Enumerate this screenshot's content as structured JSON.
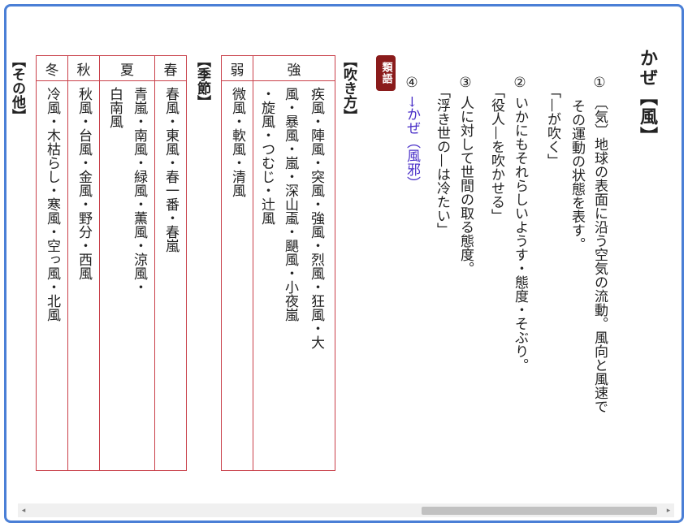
{
  "entry": {
    "reading": "かぜ",
    "headword": "【風】",
    "senses": [
      {
        "num": "①",
        "label": "〔気〕",
        "text": "地球の表面に沿う空気の流動。風向と風速で",
        "text2": "その運動の状態を表す。",
        "example": "「—が吹く」"
      },
      {
        "num": "②",
        "text": "いかにもそれらしいようす・態度・そぶり。",
        "example": "「役人—を吹かせる」"
      },
      {
        "num": "③",
        "text": "人に対して世間の取る態度。",
        "example": "「浮き世の—は冷たい」"
      },
      {
        "num": "④",
        "arrow": "→",
        "link": "かぜ（風邪）"
      }
    ]
  },
  "badge": "類語",
  "blow": {
    "title": "【吹き方】",
    "strong": {
      "head": "強",
      "line1": "疾風・陣風・突風・強風・烈風・狂風・大",
      "line2": "風・暴風・嵐・深山颪・颶風・小夜嵐",
      "line3": "・旋風・つむじ・辻風"
    },
    "weak": {
      "head": "弱",
      "line1": "微風・軟風・清風"
    }
  },
  "season": {
    "title": "【季節】",
    "spring": {
      "head": "春",
      "line1": "春風・東風・春一番・春嵐"
    },
    "summer": {
      "head": "夏",
      "line1": "青嵐・南風・緑風・薫風・涼風・",
      "line2": "白南風"
    },
    "autumn": {
      "head": "秋",
      "line1": "秋風・台風・金風・野分・西風"
    },
    "winter": {
      "head": "冬",
      "line1": "冷風・木枯らし・寒風・空っ風・北風"
    }
  },
  "next_title": "【その他】",
  "scroll": {
    "left": "◂",
    "right": "▸"
  }
}
